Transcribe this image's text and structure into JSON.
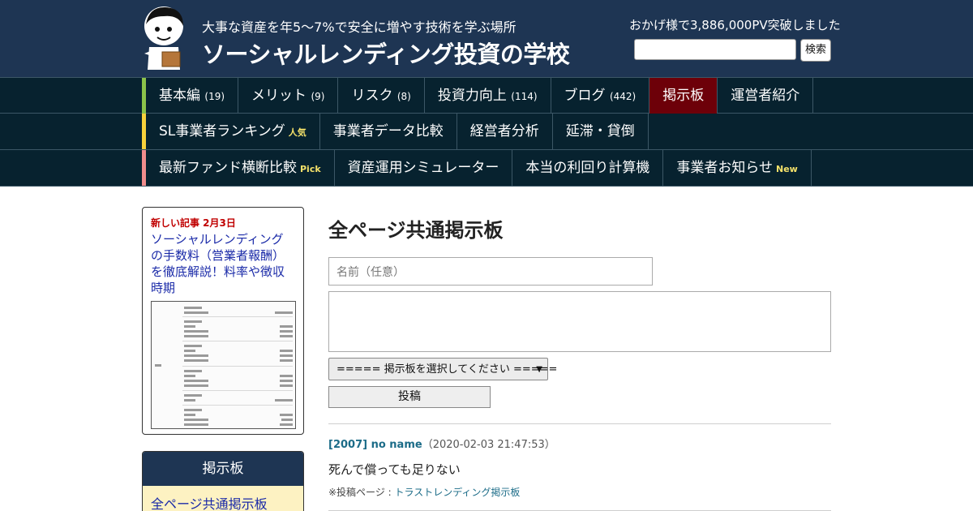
{
  "header": {
    "tagline": "大事な資産を年5～7%で安全に増やす技術を学ぶ場所",
    "title": "ソーシャルレンディング投資の学校",
    "pv_notice": "おかげ様で3,886,000PV突破しました",
    "search_button": "検索",
    "search_value": ""
  },
  "nav": {
    "row1": [
      {
        "label": "基本編",
        "count": "(19)"
      },
      {
        "label": "メリット",
        "count": "(9)"
      },
      {
        "label": "リスク",
        "count": "(8)"
      },
      {
        "label": "投資力向上",
        "count": "(114)"
      },
      {
        "label": "ブログ",
        "count": "(442)"
      },
      {
        "label": "掲示板",
        "active": true
      },
      {
        "label": "運営者紹介"
      }
    ],
    "row2": [
      {
        "label": "SL事業者ランキング",
        "tag": "人気"
      },
      {
        "label": "事業者データ比較"
      },
      {
        "label": "経営者分析"
      },
      {
        "label": "延滞・貸倒"
      }
    ],
    "row3": [
      {
        "label": "最新ファンド横断比較",
        "tag": "Pick"
      },
      {
        "label": "資産運用シミュレーター"
      },
      {
        "label": "本当の利回り計算機"
      },
      {
        "label": "事業者お知らせ",
        "tag": "New"
      }
    ]
  },
  "sidebar": {
    "new_article_date": "新しい記事 2月3日",
    "new_article_title": "ソーシャルレンディングの手数料（営業者報酬）を徹底解説！料率や徴収時期",
    "bbs_heading": "掲示板",
    "bbs_link": "全ページ共通掲示板"
  },
  "main": {
    "page_title": "全ページ共通掲示板",
    "name_placeholder": "名前（任意）",
    "board_select": "===== 掲示板を選択してください =====",
    "post_button": "投稿",
    "posts": [
      {
        "author": "[2007] no name",
        "timestamp": "（2020-02-03 21:47:53）",
        "body": "死んで償っても足りない",
        "source_prefix": "※投稿ページ : ",
        "source_link": "トラストレンディング掲示板"
      }
    ]
  },
  "colors": {
    "header_bg": "#1e3553",
    "nav_bg": "#07222f",
    "active_nav": "#6d0009",
    "row1_accent": "#8bc34a",
    "row2_accent": "#f7d13b",
    "row3_accent": "#f08c8c",
    "link": "#1a2aa8"
  }
}
